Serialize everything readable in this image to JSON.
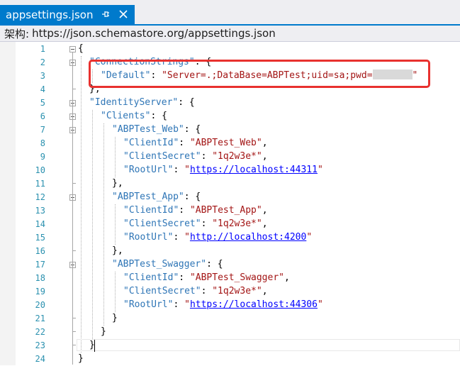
{
  "tab": {
    "title": "appsettings.json",
    "pin_icon": "pin-icon",
    "close_icon": "close-icon"
  },
  "schema": {
    "label": "架构:",
    "url": "https://json.schemastore.org/appsettings.json"
  },
  "colors": {
    "accent": "#007acc",
    "key": "#2e75b6",
    "string": "#a31515",
    "url": "#0000ff",
    "line_number": "#2b91af",
    "highlight_border": "#e8312f"
  },
  "line_numbers": [
    "1",
    "2",
    "3",
    "4",
    "5",
    "6",
    "7",
    "8",
    "9",
    "10",
    "11",
    "12",
    "13",
    "14",
    "15",
    "16",
    "17",
    "18",
    "19",
    "20",
    "21",
    "22",
    "23",
    "24"
  ],
  "code": {
    "l1": {
      "p": "{"
    },
    "l2": {
      "k": "\"ConnectionStrings\"",
      "p": ": {"
    },
    "l3": {
      "k": "\"Default\"",
      "p1": ": ",
      "s": "\"Server=.;DataBase=ABPTest;uid=sa;pwd=",
      "s_end": "\""
    },
    "l4": {
      "p": "},"
    },
    "l5": {
      "k": "\"IdentityServer\"",
      "p": ": {"
    },
    "l6": {
      "k": "\"Clients\"",
      "p": ": {"
    },
    "l7": {
      "k": "\"ABPTest_Web\"",
      "p": ": {"
    },
    "l8": {
      "k": "\"ClientId\"",
      "p1": ": ",
      "s": "\"ABPTest_Web\"",
      "p2": ","
    },
    "l9": {
      "k": "\"ClientSecret\"",
      "p1": ": ",
      "s": "\"1q2w3e*\"",
      "p2": ","
    },
    "l10": {
      "k": "\"RootUrl\"",
      "p1": ": ",
      "q1": "\"",
      "u": "https://localhost:44311",
      "q2": "\""
    },
    "l11": {
      "p": "},"
    },
    "l12": {
      "k": "\"ABPTest_App\"",
      "p": ": {"
    },
    "l13": {
      "k": "\"ClientId\"",
      "p1": ": ",
      "s": "\"ABPTest_App\"",
      "p2": ","
    },
    "l14": {
      "k": "\"ClientSecret\"",
      "p1": ": ",
      "s": "\"1q2w3e*\"",
      "p2": ","
    },
    "l15": {
      "k": "\"RootUrl\"",
      "p1": ": ",
      "q1": "\"",
      "u": "http://localhost:4200",
      "q2": "\""
    },
    "l16": {
      "p": "},"
    },
    "l17": {
      "k": "\"ABPTest_Swagger\"",
      "p": ": {"
    },
    "l18": {
      "k": "\"ClientId\"",
      "p1": ": ",
      "s": "\"ABPTest_Swagger\"",
      "p2": ","
    },
    "l19": {
      "k": "\"ClientSecret\"",
      "p1": ": ",
      "s": "\"1q2w3e*\"",
      "p2": ","
    },
    "l20": {
      "k": "\"RootUrl\"",
      "p1": ": ",
      "q1": "\"",
      "u": "https://localhost:44306",
      "q2": "\""
    },
    "l21": {
      "p": "}"
    },
    "l22": {
      "p": "}"
    },
    "l23": {
      "p": "}"
    },
    "l24": {
      "p": "}"
    }
  }
}
